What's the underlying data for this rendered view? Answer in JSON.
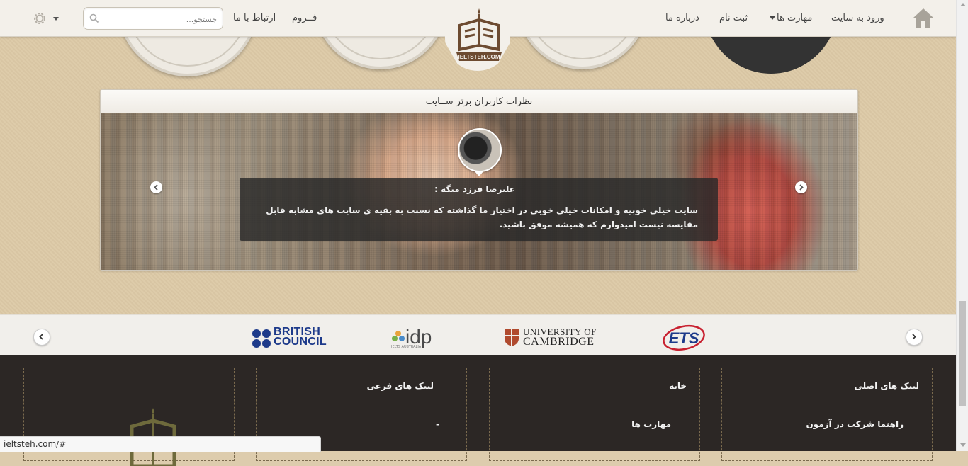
{
  "nav": {
    "home_icon": "home-icon",
    "login": "ورود به سایت",
    "skills": "مهارت ها",
    "register": "ثبت نام",
    "about": "درباره ما",
    "forum": "فــروم",
    "contact": "ارتباط با ما",
    "search_placeholder": "جستجو...",
    "settings_icon": "gear-icon"
  },
  "logo": {
    "text": "IELTSTEH.COM"
  },
  "testimonials": {
    "title": "نظرات کاربران برتر ســایت",
    "author": "علیرضا فرزد میگه :",
    "text": "سایت خیلی خوبیه و امکانات خیلی خوبی در اختیار ما گذاشته که نسبت به بقیه ی سایت های مشابه قابل مقایسه نیست امیدوارم که همیشه موفق باشید."
  },
  "partners": {
    "british_council": [
      "BRITISH",
      "COUNCIL"
    ],
    "idp": "idp",
    "idp_sub": "IELTS AUSTRALIA",
    "cambridge": [
      "UNIVERSITY OF",
      "CAMBRIDGE"
    ],
    "ets": "ETS"
  },
  "footer": {
    "col_main": {
      "title": "لینک های اصلی",
      "links": [
        "راهنما شرکت در آزمون"
      ]
    },
    "col_home": {
      "title": "خانه",
      "links": [
        "مهارت ها"
      ]
    },
    "col_sub": {
      "title": "لینک های فرعی",
      "links": [
        "-"
      ]
    }
  },
  "status_url": "ieltsteh.com/#",
  "colors": {
    "page_bg": "#dcc9a6",
    "footer_bg": "#2c2725",
    "accent_brown": "#7a5a3a"
  }
}
